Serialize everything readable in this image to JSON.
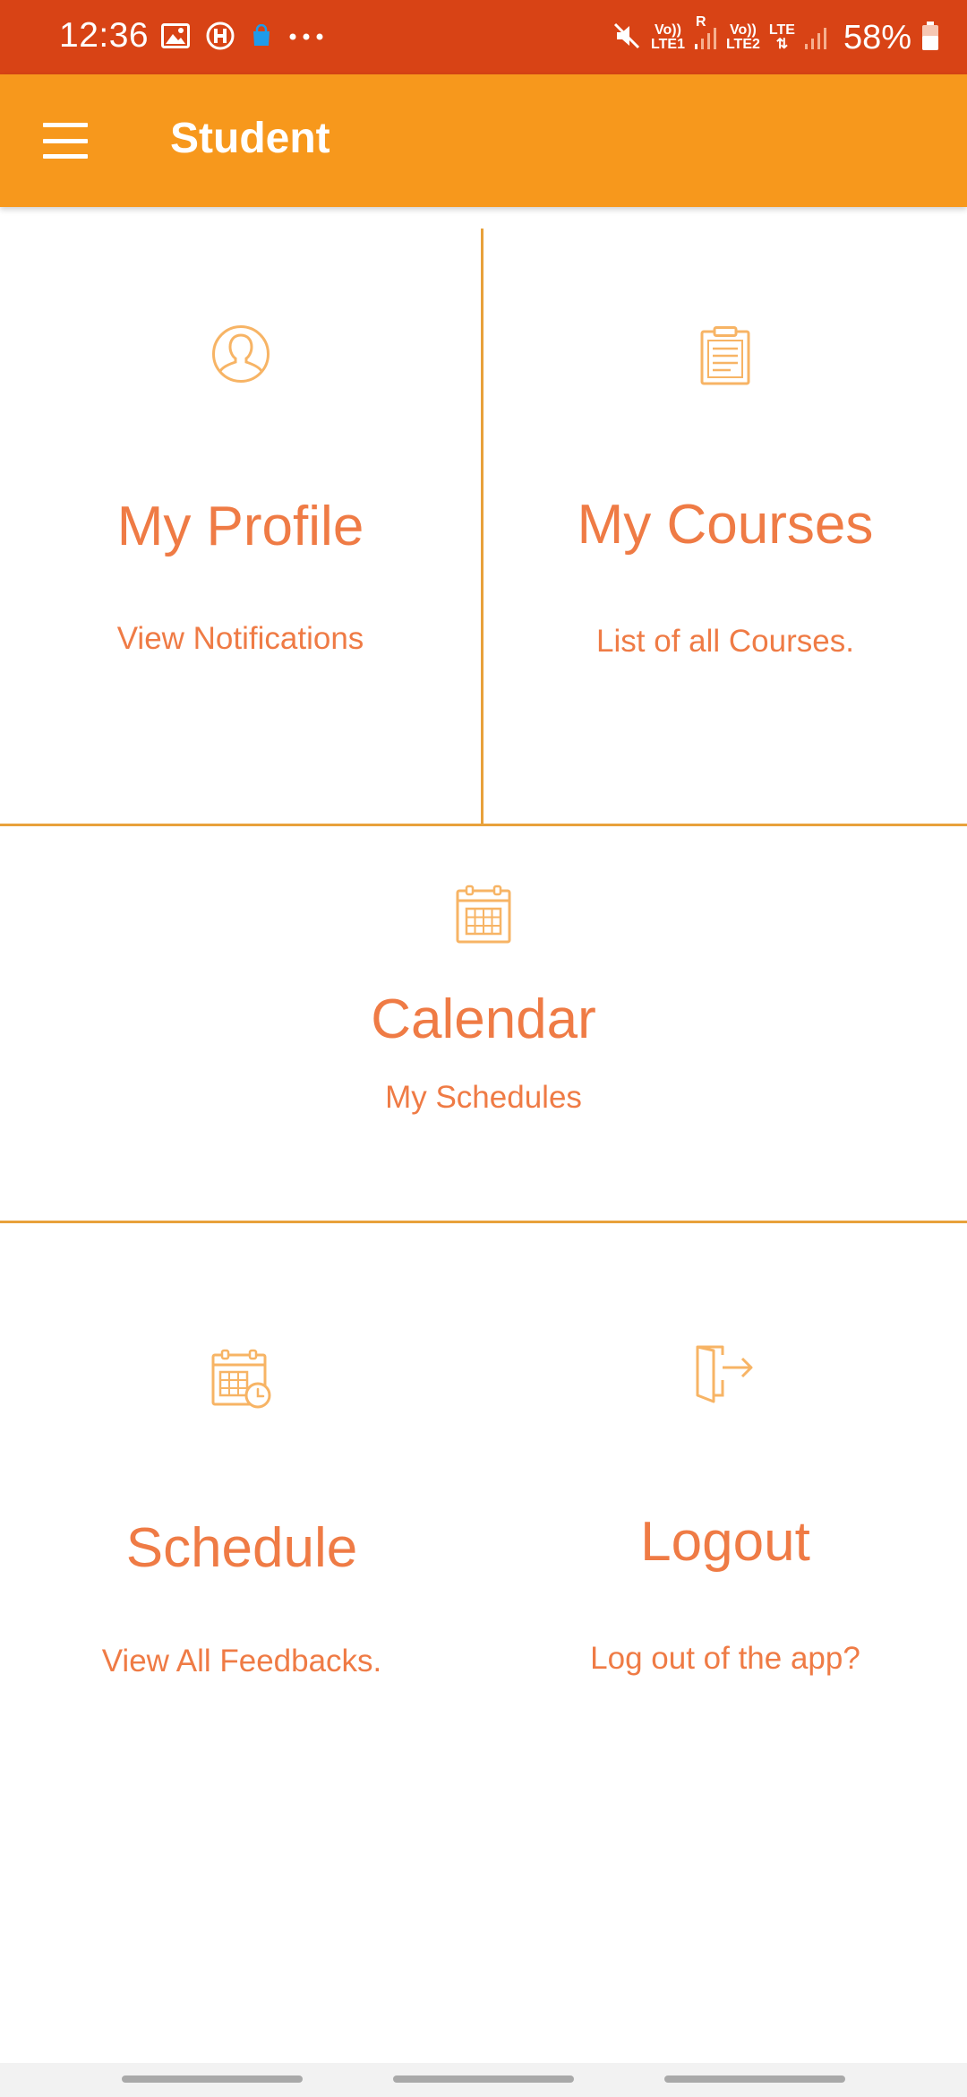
{
  "status_bar": {
    "time": "12:36",
    "left_icons": [
      "gallery-icon",
      "hospital-icon",
      "shopping-bag-icon",
      "more-dots-icon"
    ],
    "sim1_label_top": "Vo))",
    "sim1_label_bottom": "LTE1",
    "sim1_roaming": "R",
    "sim2_label_top": "Vo))",
    "sim2_label_bottom": "LTE2",
    "sim2_network": "LTE",
    "battery_percent": "58%"
  },
  "app_bar": {
    "title": "Student",
    "menu_icon": "hamburger-menu-icon"
  },
  "tiles": {
    "profile": {
      "icon": "user-profile-icon",
      "title": "My Profile",
      "subtitle": "View Notifications"
    },
    "courses": {
      "icon": "clipboard-icon",
      "title": "My Courses",
      "subtitle": "List of all Courses."
    },
    "calendar": {
      "icon": "calendar-icon",
      "title": "Calendar",
      "subtitle": "My Schedules"
    },
    "schedule": {
      "icon": "calendar-clock-icon",
      "title": "Schedule",
      "subtitle": "View All Feedbacks."
    },
    "logout": {
      "icon": "logout-door-icon",
      "title": "Logout",
      "subtitle": "Log out of the app?"
    }
  },
  "colors": {
    "status_bar": "#d84315",
    "app_bar": "#f7981c",
    "tile_text": "#ef7b45",
    "icon_stroke": "#f7b465",
    "divider": "#e8a13b"
  }
}
